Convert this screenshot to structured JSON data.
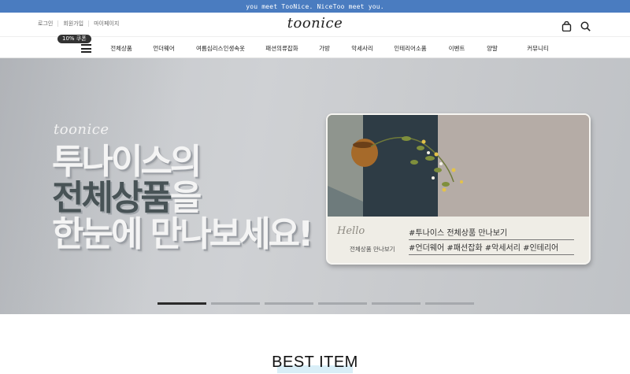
{
  "topbar": {
    "text": "you meet TooNice. NiceToo meet you."
  },
  "header": {
    "links": [
      "로그인",
      "회원가입",
      "마이페이지"
    ],
    "logo": "toonice",
    "icons": [
      "shopping-bag-icon",
      "search-icon"
    ]
  },
  "nav": {
    "coupon": "10% 쿠폰",
    "menu_icon": "hamburger-menu-icon",
    "items": [
      "전체상품",
      "언더웨어",
      "여름심리스인생속옷",
      "패션의류잡화",
      "가방",
      "악세사리",
      "인테리어소품",
      "이벤트",
      "양말",
      "커뮤니티"
    ]
  },
  "hero": {
    "brand": "toonice",
    "headline_line1": "투나이스의",
    "headline_line2_dark": "전체상품",
    "headline_line2_light": "을",
    "headline_line3": "한눈에 만나보세요!",
    "card": {
      "hello": "Hello",
      "subtitle": "전체상품 만나보기",
      "tag1": "#투나이스 전체상품 만나보기",
      "tag2": "#언더웨어 #패션잡화 #악세서리 #인테리어"
    },
    "slides_total": 6,
    "active_slide": 1
  },
  "section": {
    "title": "BEST ITEM"
  },
  "colors": {
    "topbar": "#4a7cc0",
    "hero_bg": "#c9ccd0",
    "accent_dark": "#485356"
  }
}
